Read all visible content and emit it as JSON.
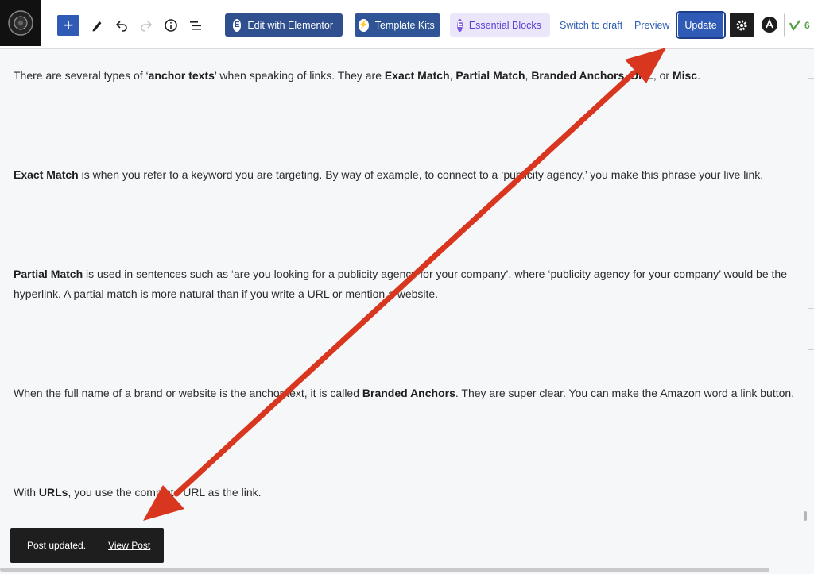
{
  "toolbar": {
    "elementor_label": "Edit with Elementor",
    "kits_label": "Template Kits",
    "essential_label": "Essential Blocks",
    "switch_label": "Switch to draft",
    "preview_label": "Preview",
    "update_label": "Update",
    "yoast_score": "6"
  },
  "content": {
    "p1": [
      {
        "t": "There are several types of ‘"
      },
      {
        "t": "anchor texts",
        "b": true
      },
      {
        "t": "’ when speaking of links. They are "
      },
      {
        "t": "Exact Match",
        "b": true
      },
      {
        "t": ", "
      },
      {
        "t": "Partial Match",
        "b": true
      },
      {
        "t": ", "
      },
      {
        "t": "Branded Anchors",
        "b": true
      },
      {
        "t": ", "
      },
      {
        "t": "URL",
        "b": true
      },
      {
        "t": ", or "
      },
      {
        "t": "Misc",
        "b": true
      },
      {
        "t": "."
      }
    ],
    "p2": [
      {
        "t": "Exact Match",
        "b": true
      },
      {
        "t": " is when you refer to a keyword you are targeting. By way of example, to connect to a ‘publicity agency,’ you make this phrase your live link."
      }
    ],
    "p3": [
      {
        "t": "Partial Match",
        "b": true
      },
      {
        "t": " is used in sentences such as ‘are you looking for a publicity agency for your company’, where ‘publicity agency for your company’ would be the hyperlink. A partial match is more natural than if you write a URL or mention a website."
      }
    ],
    "p4": [
      {
        "t": "When the full name of a brand or website is the anchor text, it is called "
      },
      {
        "t": "Branded Anchors",
        "b": true
      },
      {
        "t": ". They are super clear. You can make the Amazon word a link button."
      }
    ],
    "p5": [
      {
        "t": "With "
      },
      {
        "t": "URLs",
        "b": true
      },
      {
        "t": ", you use the complete URL as the link."
      }
    ]
  },
  "snackbar": {
    "message": "Post updated.",
    "action": "View Post"
  },
  "colors": {
    "accent": "#2f5bb7",
    "arrow": "#d9361f",
    "essential_blocks": "#7b58e4",
    "yoast_green": "#5ba14a"
  },
  "icons": [
    "plus-icon",
    "pen-icon",
    "undo-icon",
    "redo-icon",
    "info-icon",
    "list-view-icon",
    "elementor-icon",
    "template-kits-icon",
    "essential-blocks-icon",
    "gear-icon",
    "astra-icon",
    "yoast-icon"
  ]
}
